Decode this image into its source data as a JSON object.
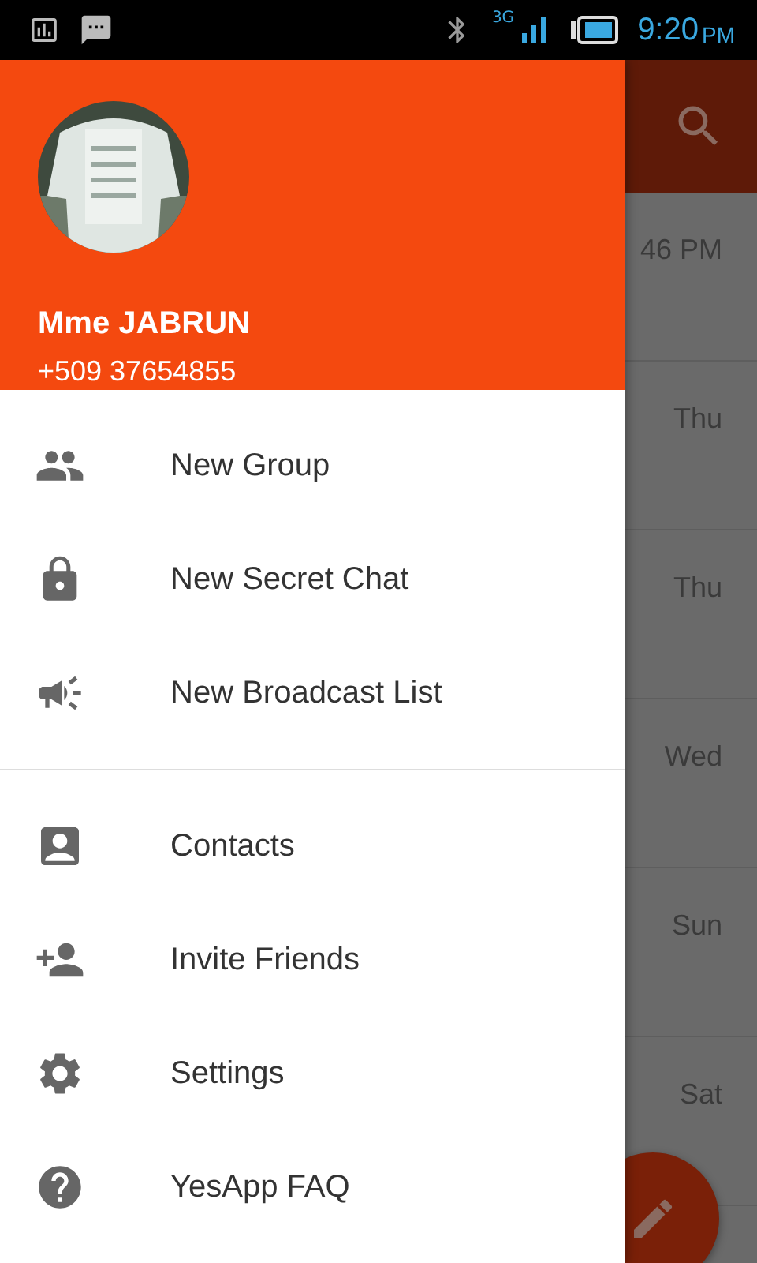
{
  "status_bar": {
    "network": "3G",
    "time": "9:20",
    "period": "PM"
  },
  "background_list": {
    "times": [
      "46 PM",
      "Thu",
      "Thu",
      "Wed",
      "Sun",
      "Sat"
    ]
  },
  "drawer": {
    "name": "Mme JABRUN",
    "phone": "+509 37654855",
    "sections": [
      [
        {
          "label": "New Group"
        },
        {
          "label": "New Secret Chat"
        },
        {
          "label": "New Broadcast List"
        }
      ],
      [
        {
          "label": "Contacts"
        },
        {
          "label": "Invite Friends"
        },
        {
          "label": "Settings"
        },
        {
          "label": "YesApp FAQ"
        }
      ]
    ]
  }
}
